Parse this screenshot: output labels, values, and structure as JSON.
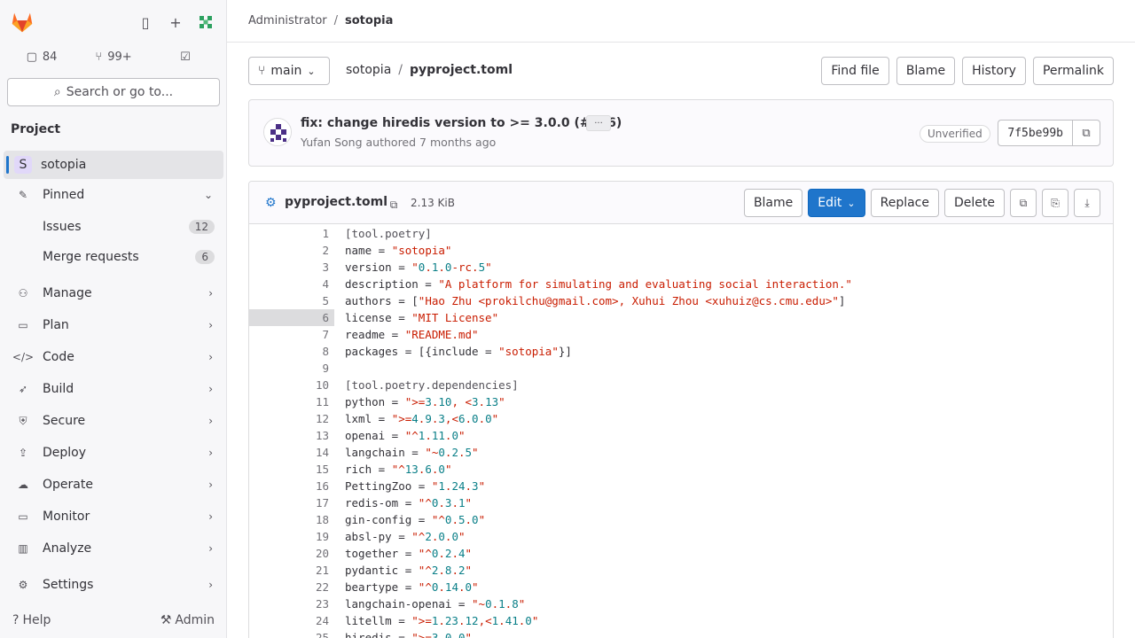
{
  "sidebar": {
    "counters": {
      "issues": "84",
      "merge_requests": "99+"
    },
    "search_label": "Search or go to...",
    "section_title": "Project",
    "project": {
      "initial": "S",
      "name": "sotopia"
    },
    "items": [
      {
        "label": "Pinned"
      },
      {
        "label": "Issues",
        "count": "12"
      },
      {
        "label": "Merge requests",
        "count": "6"
      },
      {
        "label": "Manage"
      },
      {
        "label": "Plan"
      },
      {
        "label": "Code"
      },
      {
        "label": "Build"
      },
      {
        "label": "Secure"
      },
      {
        "label": "Deploy"
      },
      {
        "label": "Operate"
      },
      {
        "label": "Monitor"
      },
      {
        "label": "Analyze"
      },
      {
        "label": "Settings"
      }
    ],
    "help": "Help",
    "admin": "Admin"
  },
  "breadcrumb": {
    "parent": "Administrator",
    "current": "sotopia"
  },
  "file_nav": {
    "branch": "main",
    "path_root": "sotopia",
    "path_file": "pyproject.toml",
    "buttons": {
      "find_file": "Find file",
      "blame": "Blame",
      "history": "History",
      "permalink": "Permalink"
    }
  },
  "commit": {
    "title": "fix: change hiredis version to >= 3.0.0 (#216)",
    "toggle": "···",
    "author": "Yufan Song",
    "authored": "authored",
    "time": "7 months ago",
    "signature": "Unverified",
    "sha": "7f5be99b"
  },
  "file": {
    "name": "pyproject.toml",
    "size": "2.13 KiB",
    "buttons": {
      "blame": "Blame",
      "edit": "Edit",
      "replace": "Replace",
      "delete": "Delete"
    }
  },
  "code_lines": [
    "[tool.poetry]",
    "name = \"sotopia\"",
    "version = \"0.1.0-rc.5\"",
    "description = \"A platform for simulating and evaluating social interaction.\"",
    "authors = [\"Hao Zhu <prokilchu@gmail.com>, Xuhui Zhou <xuhuiz@cs.cmu.edu>\"]",
    "license = \"MIT License\"",
    "readme = \"README.md\"",
    "packages = [{include = \"sotopia\"}]",
    "",
    "[tool.poetry.dependencies]",
    "python = \">=3.10, <3.13\"",
    "lxml = \">=4.9.3,<6.0.0\"",
    "openai = \"^1.11.0\"",
    "langchain = \"~0.2.5\"",
    "rich = \"^13.6.0\"",
    "PettingZoo = \"1.24.3\"",
    "redis-om = \"^0.3.1\"",
    "gin-config = \"^0.5.0\"",
    "absl-py = \"^2.0.0\"",
    "together = \"^0.2.4\"",
    "pydantic = \"^2.8.2\"",
    "beartype = \"^0.14.0\"",
    "langchain-openai = \"~0.1.8\"",
    "litellm = \">=1.23.12,<1.41.0\"",
    "hiredis = \">=3.0.0\""
  ],
  "highlighted_line": 6,
  "colors": {
    "accent": "#1f75cb",
    "string": "#c91c00",
    "number": "#0a7f88"
  }
}
